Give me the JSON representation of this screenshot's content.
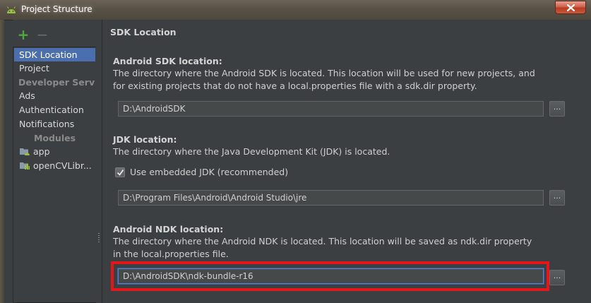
{
  "window": {
    "title": "Project Structure"
  },
  "sidebar": {
    "toolbar": {
      "add_glyph": "+",
      "remove_glyph": "−"
    },
    "items": [
      {
        "label": "SDK Location",
        "selected": true
      },
      {
        "label": "Project"
      }
    ],
    "developer_services_header": "Developer Servi...",
    "services": [
      {
        "label": "Ads"
      },
      {
        "label": "Authentication"
      },
      {
        "label": "Notifications"
      }
    ],
    "modules_header": "Modules",
    "modules": [
      {
        "label": "app",
        "icon": "android-module-icon"
      },
      {
        "label": "openCVLibr...",
        "icon": "library-module-icon"
      }
    ]
  },
  "main": {
    "page_title": "SDK Location",
    "android_sdk": {
      "title": "Android SDK location:",
      "description": "The directory where the Android SDK is located. This location will be used for new projects, and for existing projects that do not have a local.properties file with a sdk.dir property.",
      "value": "D:\\AndroidSDK",
      "browse_label": "..."
    },
    "jdk": {
      "title": "JDK location:",
      "description": "The directory where the Java Development Kit (JDK) is located.",
      "embedded_label": "Use embedded JDK (recommended)",
      "embedded_checked": true,
      "value": "D:\\Program Files\\Android\\Android Studio\\jre",
      "browse_label": "..."
    },
    "android_ndk": {
      "title": "Android NDK location:",
      "description": "The directory where the Android NDK is located. This location will be saved as ndk.dir property in the local.properties file.",
      "value": "D:\\AndroidSDK\\ndk-bundle-r16",
      "browse_label": "..."
    }
  },
  "colors": {
    "background": "#3c3f41",
    "selection": "#4b6eaf",
    "highlight_annotation": "#e3161b",
    "add_button": "#4fa83b"
  }
}
